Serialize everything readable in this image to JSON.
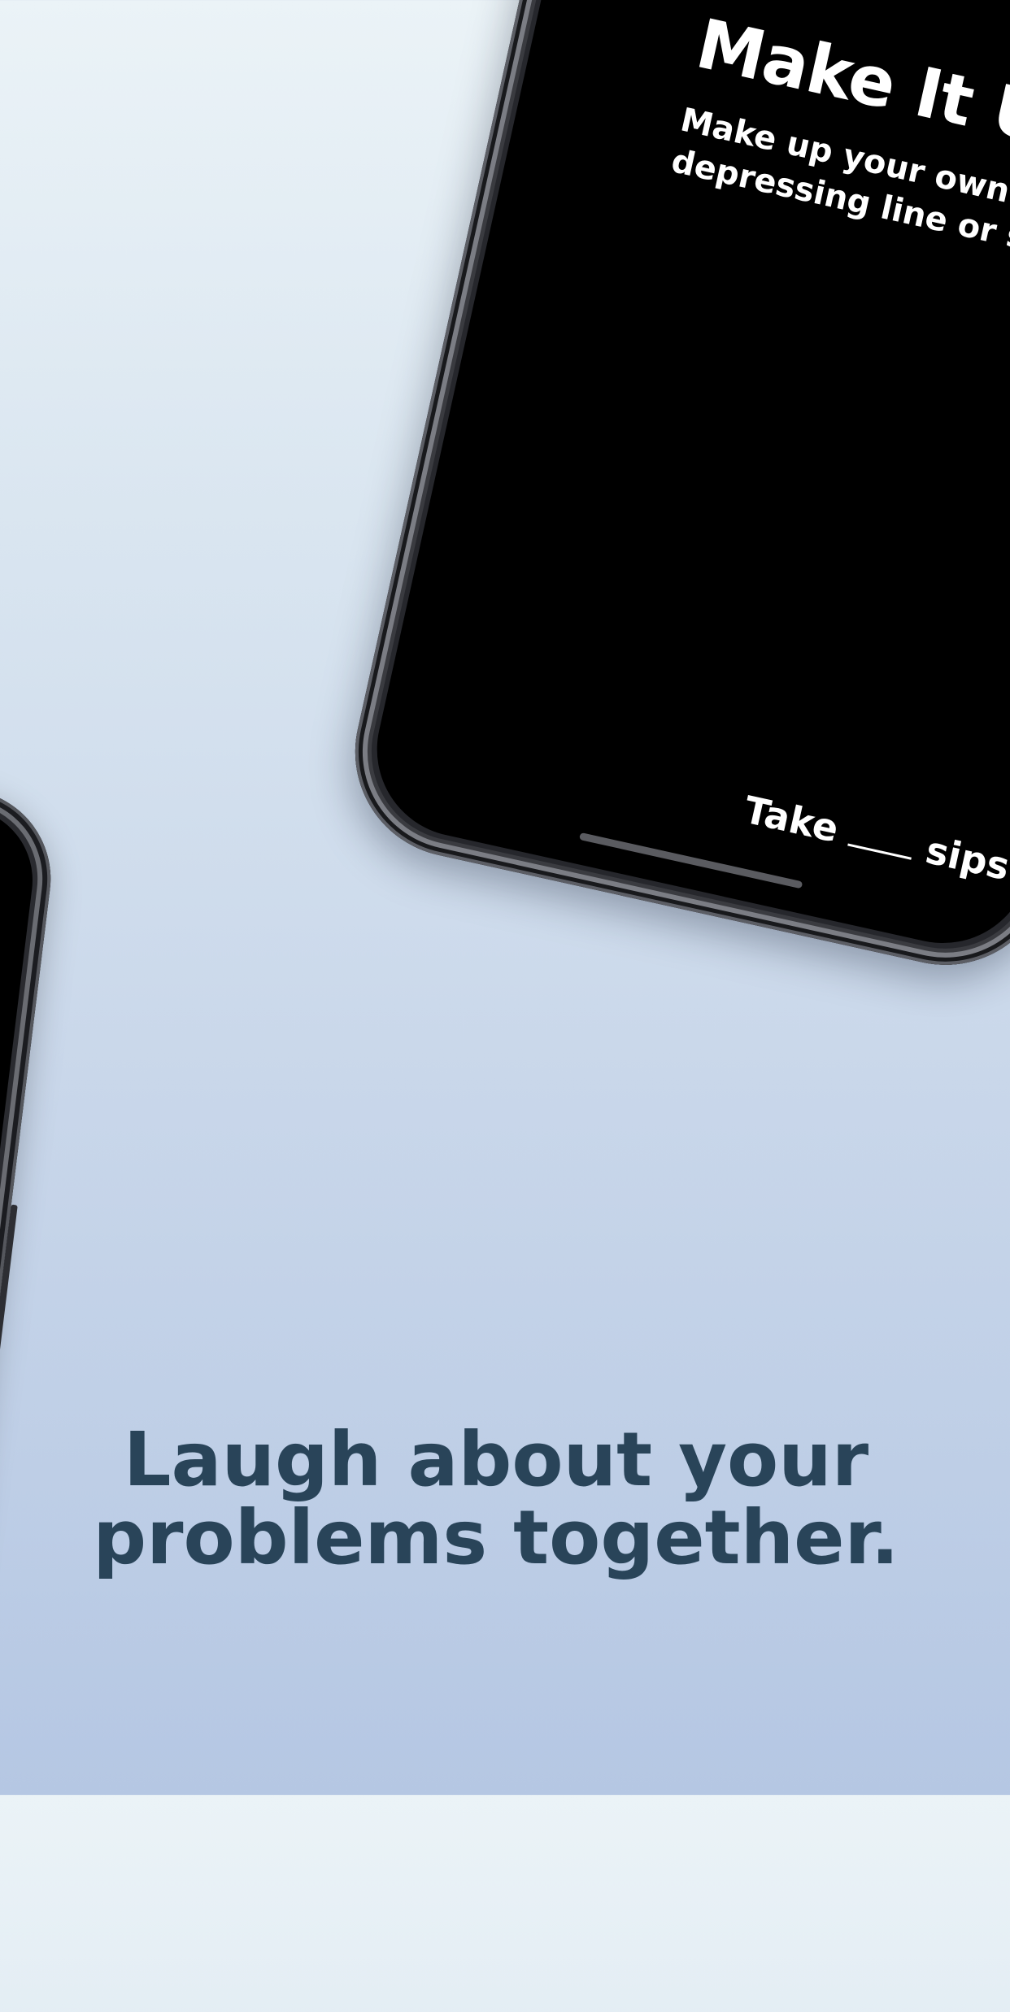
{
  "card": {
    "title": "Make It Up",
    "subtitle": "Make up your own depressing line or story.",
    "footer_prefix": "Take",
    "footer_suffix": "sips!"
  },
  "tagline": {
    "line1": "Laugh about your",
    "line2": "problems together."
  },
  "colors": {
    "background_top": "#ebf3f7",
    "background_bottom": "#b5c7e3",
    "tagline": "#294459",
    "screen": "#000000",
    "card_text": "#ffffff"
  }
}
